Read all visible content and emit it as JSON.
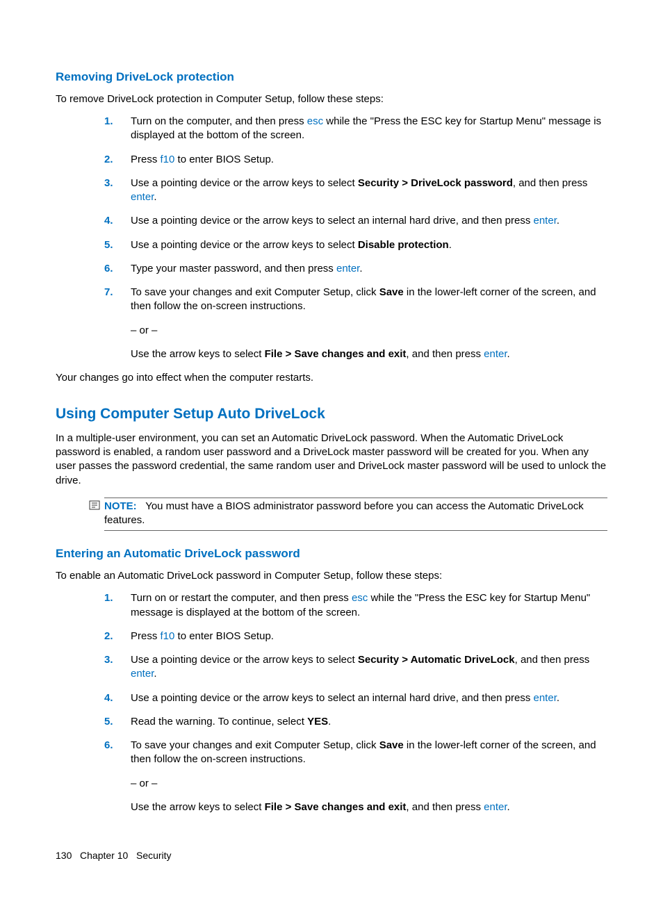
{
  "section1": {
    "heading": "Removing DriveLock protection",
    "intro": "To remove DriveLock protection in Computer Setup, follow these steps:",
    "steps": [
      {
        "n": "1.",
        "pre": "Turn on the computer, and then press ",
        "key": "esc",
        "post": " while the \"Press the ESC key for Startup Menu\" message is displayed at the bottom of the screen."
      },
      {
        "n": "2.",
        "pre": "Press ",
        "key": "f10",
        "post": " to enter BIOS Setup."
      },
      {
        "n": "3.",
        "pre": "Use a pointing device or the arrow keys to select ",
        "bold": "Security > DriveLock password",
        "mid": ", and then press ",
        "key": "enter",
        "post": "."
      },
      {
        "n": "4.",
        "pre": "Use a pointing device or the arrow keys to select an internal hard drive, and then press ",
        "key": "enter",
        "post": "."
      },
      {
        "n": "5.",
        "pre": "Use a pointing device or the arrow keys to select ",
        "bold": "Disable protection",
        "post": "."
      },
      {
        "n": "6.",
        "pre": "Type your master password, and then press ",
        "key": "enter",
        "post": "."
      },
      {
        "n": "7.",
        "pre": "To save your changes and exit Computer Setup, click ",
        "bold": "Save",
        "post": " in the lower-left corner of the screen, and then follow the on-screen instructions.",
        "or": "– or –",
        "alt_pre": "Use the arrow keys to select ",
        "alt_bold": "File > Save changes and exit",
        "alt_mid": ", and then press ",
        "alt_key": "enter",
        "alt_post": "."
      }
    ],
    "outro": "Your changes go into effect when the computer restarts."
  },
  "section2": {
    "heading": "Using Computer Setup Auto DriveLock",
    "intro": "In a multiple-user environment, you can set an Automatic DriveLock password. When the Automatic DriveLock password is enabled, a random user password and a DriveLock master password will be created for you. When any user passes the password credential, the same random user and DriveLock master password will be used to unlock the drive.",
    "note_label": "NOTE:",
    "note_text": "You must have a BIOS administrator password before you can access the Automatic DriveLock features."
  },
  "section3": {
    "heading": "Entering an Automatic DriveLock password",
    "intro": "To enable an Automatic DriveLock password in Computer Setup, follow these steps:",
    "steps": [
      {
        "n": "1.",
        "pre": "Turn on or restart the computer, and then press ",
        "key": "esc",
        "post": " while the \"Press the ESC key for Startup Menu\" message is displayed at the bottom of the screen."
      },
      {
        "n": "2.",
        "pre": "Press ",
        "key": "f10",
        "post": " to enter BIOS Setup."
      },
      {
        "n": "3.",
        "pre": "Use a pointing device or the arrow keys to select ",
        "bold": "Security > Automatic DriveLock",
        "mid": ", and then press ",
        "key": "enter",
        "post": "."
      },
      {
        "n": "4.",
        "pre": "Use a pointing device or the arrow keys to select an internal hard drive, and then press ",
        "key": "enter",
        "post": "."
      },
      {
        "n": "5.",
        "pre": "Read the warning. To continue, select ",
        "bold": "YES",
        "post": "."
      },
      {
        "n": "6.",
        "pre": "To save your changes and exit Computer Setup, click ",
        "bold": "Save",
        "post": " in the lower-left corner of the screen, and then follow the on-screen instructions.",
        "or": "– or –",
        "alt_pre": "Use the arrow keys to select ",
        "alt_bold": "File > Save changes and exit",
        "alt_mid": ", and then press ",
        "alt_key": "enter",
        "alt_post": "."
      }
    ]
  },
  "footer": {
    "page": "130",
    "chapter": "Chapter 10",
    "title": "Security"
  }
}
